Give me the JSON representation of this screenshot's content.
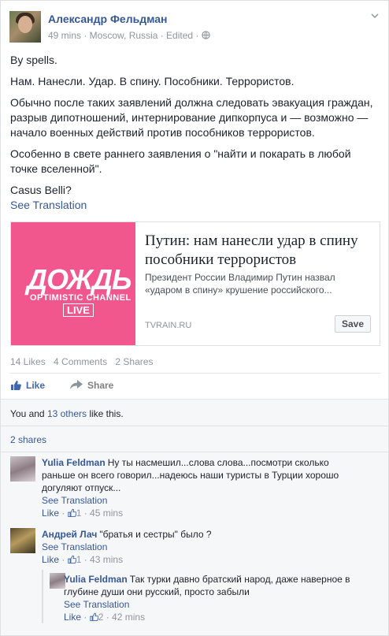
{
  "post": {
    "author": "Александр Фельдман",
    "meta": "49 mins · Moscow, Russia · Edited · ",
    "paragraphs": [
      "By spells.",
      "Нам. Нанесли. Удар. В спину. Пособники. Террористов.",
      "Обычно после таких заявлений должна следовать эвакуация граждан, разрыв дипотношений, интернирование дипкорпуса и — возможно — начало военных действий против пособников террористов.",
      "Особенно в свете раннего заявления о \"найти и покарать в любой точке вселенной\".",
      "Casus Belli?"
    ],
    "see_translation": "See Translation"
  },
  "link": {
    "logo_word": "ДОЖДЬ",
    "logo_sub1": "OPTIMISTIC CHANNEL",
    "logo_sub2": "LIVE",
    "title": "Путин: нам нанесли удар в спину пособники террористов",
    "description": "Президент России Владимир Путин назвал «ударом в спину» крушение российского...",
    "domain": "TVRAIN.RU",
    "save_label": "Save"
  },
  "stats": {
    "likes": "14 Likes",
    "comments": "4 Comments",
    "shares": "2 Shares"
  },
  "actions": {
    "like": "Like",
    "share": "Share"
  },
  "feedback": {
    "likes_prefix": "You and ",
    "likes_link": "13 others",
    "likes_suffix": " like this.",
    "shares": "2 shares"
  },
  "comments": [
    {
      "name": "Yulia Feldman",
      "text": "Ну ты насмешил...слова слова...посмотри сколько раньше он всего говорил...надеюсь наши туристы в Турции хорошо догуляют отпуск...",
      "see_translation": "See Translation",
      "like": "Like",
      "count": "1",
      "time": "45 mins"
    },
    {
      "name": "Андрей Лач",
      "text": "\"братья и сестры\" было ?",
      "see_translation": "See Translation",
      "like": "Like",
      "count": "1",
      "time": "43 mins"
    },
    {
      "name": "Yulia Feldman",
      "text": "Так турки давно братский народ, даже наверное в глубине души они русский, просто забыли",
      "see_translation": "See Translation",
      "like": "Like",
      "count": "2",
      "time": "42 mins"
    }
  ],
  "colors": {
    "link_blue": "#365899",
    "brand_pink": "#f1578c",
    "meta_gray": "#90949c"
  }
}
